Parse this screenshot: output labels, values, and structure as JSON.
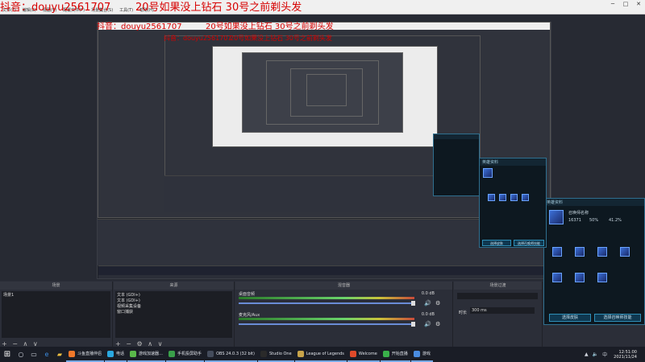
{
  "overlay": {
    "line1_left": "抖音：douyu2561707",
    "line1_right": "20号如果没上钻石  30号之前剃头发"
  },
  "window": {
    "menu": [
      "文件(F)",
      "编辑(E)",
      "视图(V)",
      "配置文件(P)",
      "场景集合(S)",
      "工具(T)",
      "帮助(H)"
    ],
    "controls": [
      "─",
      "□",
      "✕"
    ]
  },
  "docks": {
    "scenes": {
      "title": "场景",
      "items": [
        "场景1"
      ]
    },
    "sources": {
      "title": "来源",
      "items": [
        "文本 (GDI+)",
        "文本 (GDI+)",
        "视频采集设备",
        "窗口捕获"
      ]
    },
    "mixer": {
      "title": "混音器",
      "tracks": [
        {
          "name": "桌面音频",
          "level": "0.0 dB"
        },
        {
          "name": "麦克风/Aux",
          "level": "0.0 dB"
        }
      ]
    },
    "transitions": {
      "title": "场景过渡",
      "duration_label": "时长",
      "duration": "300 ms"
    }
  },
  "game_panel": {
    "title": "英雄资料",
    "name_label": "召唤师名称",
    "stats": [
      "16371",
      "50%",
      "41.2%"
    ],
    "btn_left": "选择皮肤",
    "btn_right": "选择召唤师技能"
  },
  "taskbar": {
    "items": [
      {
        "label": "斗鱼直播伴侣",
        "color": "#f0782a"
      },
      {
        "label": "电话",
        "color": "#2aa8e0"
      },
      {
        "label": "游戏加速器…",
        "color": "#5ab84a"
      },
      {
        "label": "手机投屏助手",
        "color": "#3aa04a"
      },
      {
        "label": "OBS 24.0.3 (32 bit)",
        "color": "#444c5c"
      },
      {
        "label": "Studio One",
        "color": "#2a2a2a"
      },
      {
        "label": "League of Legends",
        "color": "#c8a44a"
      },
      {
        "label": "Welcome",
        "color": "#e04a2a"
      },
      {
        "label": "开始直播",
        "color": "#3ab04a"
      },
      {
        "label": "游戏",
        "color": "#4a8ce0"
      }
    ],
    "clock_time": "12:51:00",
    "clock_date": "2021/11/24",
    "lang": "中"
  },
  "colors": {
    "accent": "#76a9e6",
    "overlay_red": "#d60000",
    "obs_bg": "#2b2e38"
  }
}
